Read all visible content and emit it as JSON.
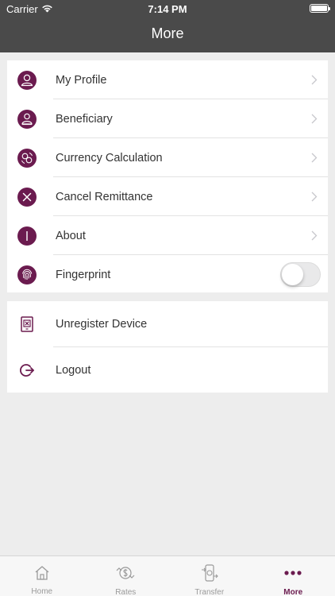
{
  "status_bar": {
    "carrier": "Carrier",
    "time": "7:14 PM"
  },
  "nav": {
    "title": "More"
  },
  "menu_items": [
    {
      "label": "My Profile",
      "icon": "profile-icon"
    },
    {
      "label": "Beneficiary",
      "icon": "beneficiary-icon"
    },
    {
      "label": "Currency Calculation",
      "icon": "currency-icon"
    },
    {
      "label": "Cancel Remittance",
      "icon": "cancel-icon"
    },
    {
      "label": "About",
      "icon": "info-icon"
    }
  ],
  "fingerprint": {
    "label": "Fingerprint",
    "icon": "fingerprint-icon",
    "enabled": false
  },
  "account_items": [
    {
      "label": "Unregister Device",
      "icon": "device-icon"
    },
    {
      "label": "Logout",
      "icon": "logout-icon"
    }
  ],
  "tabs": [
    {
      "label": "Home",
      "icon": "home-icon",
      "active": false
    },
    {
      "label": "Rates",
      "icon": "rates-icon",
      "active": false
    },
    {
      "label": "Transfer",
      "icon": "transfer-icon",
      "active": false
    },
    {
      "label": "More",
      "icon": "more-icon",
      "active": true
    }
  ],
  "colors": {
    "accent": "#6b1b4f",
    "header": "#4a4a4a",
    "background": "#ededed"
  }
}
